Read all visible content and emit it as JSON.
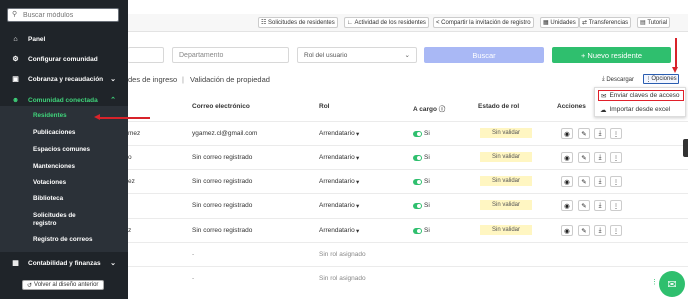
{
  "sidebar": {
    "search_placeholder": "Buscar módulos",
    "items": [
      {
        "icon": "home-icon",
        "label": "Panel"
      },
      {
        "icon": "gear-icon",
        "label": "Configurar comunidad"
      },
      {
        "icon": "wallet-icon",
        "label": "Cobranza y recaudación"
      },
      {
        "icon": "users-icon",
        "label": "Comunidad conectada"
      },
      {
        "icon": "finance-icon",
        "label": "Contabilidad y finanzas"
      }
    ],
    "submenu": [
      "Residentes",
      "Publicaciones",
      "Espacios comunes",
      "Mantenciones",
      "Votaciones",
      "Biblioteca",
      "Solicitudes de registro",
      "Registro de correos"
    ],
    "back_label": "Volver al diseño anterior"
  },
  "toolbar": {
    "requests": "Solicitudes de residentes",
    "activity": "Actividad de los residentes",
    "share": "Compartir la invitación de registro",
    "units": "Unidades",
    "transfers": "Transferencias",
    "tutorial": "Tutorial"
  },
  "filters": {
    "department_placeholder": "Departamento",
    "role_placeholder": "Rol del usuario",
    "search_button": "Buscar",
    "new_button": "+ Nuevo residente"
  },
  "tabs": {
    "tab1": "des de ingreso",
    "separator": "|",
    "tab2": "Validación de propiedad"
  },
  "actions": {
    "download": "Descargar",
    "options": "Opciones",
    "menu": [
      "Enviar claves de acceso",
      "Importar desde excel"
    ]
  },
  "table": {
    "headers": {
      "email": "Correo electrónico",
      "role": "Rol",
      "in_charge": "A cargo",
      "role_status": "Estado de rol",
      "actions": "Acciones"
    },
    "rows": [
      {
        "name": "mez",
        "email": "ygamez.cl@gmail.com",
        "role": "Arrendatario",
        "in_charge": "Si",
        "status": "Sin validar"
      },
      {
        "name": "o",
        "email": "Sin correo registrado",
        "role": "Arrendatario",
        "in_charge": "Si",
        "status": "Sin validar"
      },
      {
        "name": "ez",
        "email": "Sin correo registrado",
        "role": "Arrendatario",
        "in_charge": "Si",
        "status": "Sin validar"
      },
      {
        "name": "",
        "email": "Sin correo registrado",
        "role": "Arrendatario",
        "in_charge": "Si",
        "status": "Sin validar"
      },
      {
        "name": "z",
        "email": "Sin correo registrado",
        "role": "Arrendatario",
        "in_charge": "Si",
        "status": "Sin validar"
      },
      {
        "name": "",
        "email": "-",
        "role": "Sin rol asignado",
        "in_charge": "",
        "status": ""
      },
      {
        "name": "",
        "email": "-",
        "role": "Sin rol asignado",
        "in_charge": "",
        "status": ""
      }
    ]
  },
  "colors": {
    "sidebar": "#1f2429",
    "accent": "#2fbf6e",
    "highlight": "#e0202a",
    "search_button": "#a9b8f5"
  }
}
